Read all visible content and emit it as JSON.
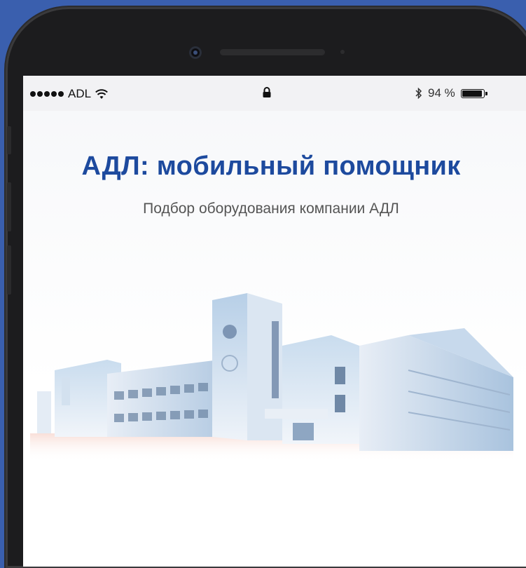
{
  "status_bar": {
    "carrier": "ADL",
    "battery_text": "94 %",
    "battery_level": 0.94,
    "icons": [
      "signal-dots-icon",
      "wifi-icon",
      "lock-icon",
      "bluetooth-icon",
      "battery-icon"
    ]
  },
  "app": {
    "title": "АДЛ: мобильный помощник",
    "subtitle": "Подбор оборудования компании АДЛ"
  },
  "colors": {
    "background": "#3a5fae",
    "title": "#1d4a9e",
    "phone_frame": "#1c1c1e"
  }
}
